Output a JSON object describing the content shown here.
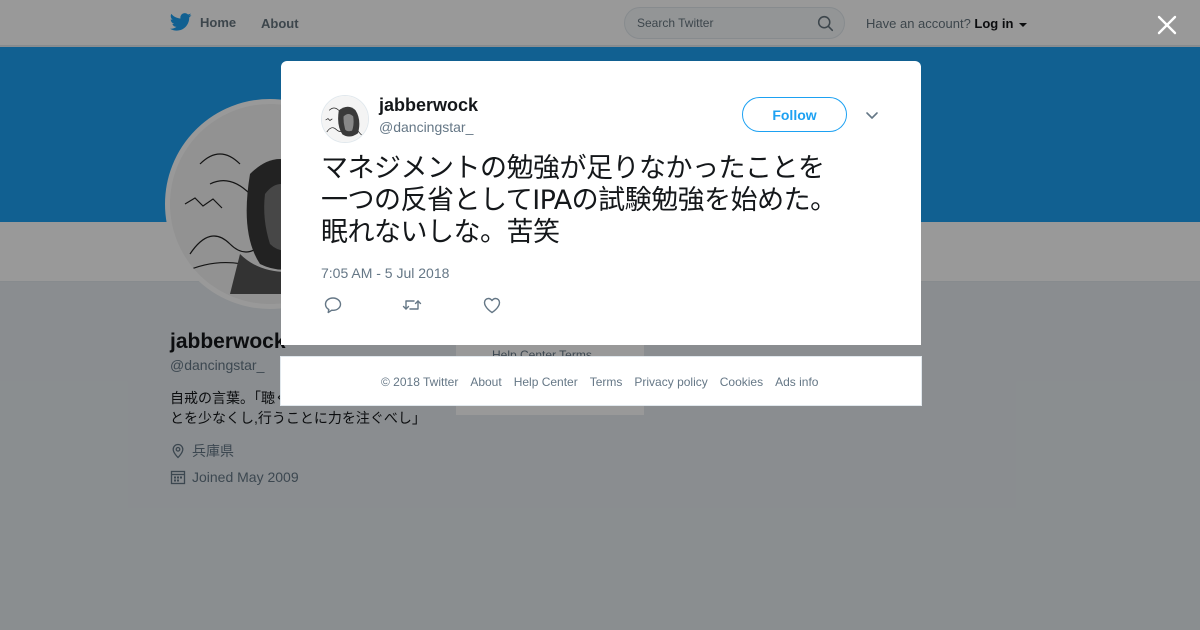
{
  "topbar": {
    "home_label": "Home",
    "about_label": "About",
    "search_placeholder": "Search Twitter",
    "account_prompt": "Have an account?",
    "login_label": "Log in"
  },
  "profile": {
    "name": "jabberwock",
    "handle": "@dancingstar_",
    "bio": "自戒の言葉。「聴くことを多くし、語ることを少なくし,行うことに力を注ぐべし」",
    "location": "兵庫県",
    "joined": "Joined May 2009",
    "mini_footer_links": "Help Center   Terms"
  },
  "tweet": {
    "name": "jabberwock",
    "handle": "@dancingstar_",
    "follow_label": "Follow",
    "text_lines": [
      "マネジメントの勉強が足りなかったことを",
      "一つの反省としてIPAの試験勉強を始めた。",
      "眠れないしな。苦笑"
    ],
    "timestamp": "7:05 AM - 5 Jul 2018"
  },
  "footer": {
    "links": [
      "© 2018 Twitter",
      "About",
      "Help Center",
      "Terms",
      "Privacy policy",
      "Cookies",
      "Ads info"
    ]
  },
  "icons": {
    "bird": "twitter-bird-icon",
    "search": "search-icon",
    "close": "close-icon",
    "reply": "reply-icon",
    "retweet": "retweet-icon",
    "like": "heart-icon",
    "more": "chevron-down-icon",
    "location": "location-pin-icon",
    "calendar": "calendar-icon"
  },
  "colors": {
    "brand": "#1da1f2",
    "text_primary": "#14171a",
    "text_secondary": "#657786"
  }
}
